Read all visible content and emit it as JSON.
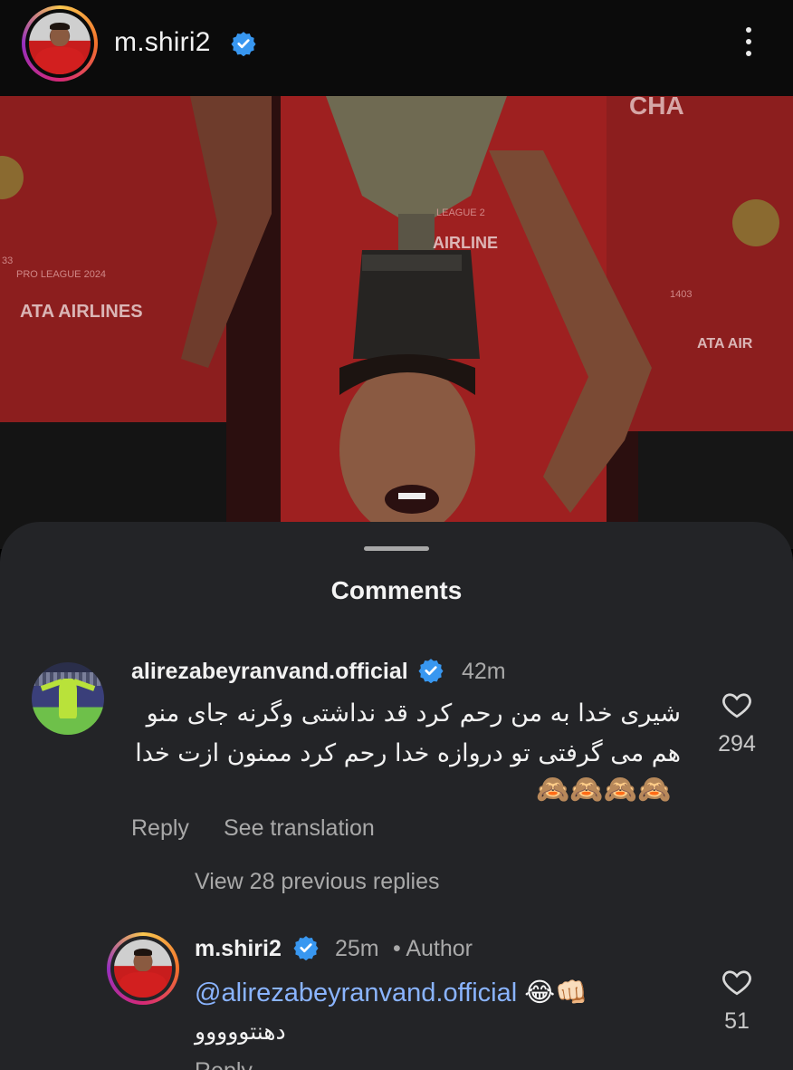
{
  "header": {
    "username": "m.shiri2",
    "verified_icon": "verified-badge-icon",
    "more_icon": "more-vertical-icon"
  },
  "colors": {
    "verified_blue": "#3897f0",
    "sheet_bg": "#232427",
    "mention_blue": "#8ab4ff"
  },
  "photo": {
    "texts": [
      "CHA",
      "LEAGUE 2",
      "AIRLINE",
      "PRO LEAGUE 2024",
      "ATA AIRLINES",
      "ATA AIR",
      "1403",
      "33"
    ]
  },
  "comments_sheet": {
    "title": "Comments",
    "comments": [
      {
        "username": "alirezabeyranvand.official",
        "time": "42m",
        "text_line1": "شیری خدا به من رحم کرد قد نداشتی وگرنه  جای منو",
        "text_line2": "هم می گرفتی تو دروازه خدا رحم کرد ممنون ازت خدا",
        "emojis": "🙈🙈🙈🙈",
        "likes": "294",
        "reply_label": "Reply",
        "translate_label": "See translation",
        "view_replies_label": "View 28 previous replies"
      }
    ],
    "reply": {
      "username": "m.shiri2",
      "time": "25m",
      "author_label": "• Author",
      "mention": "@alirezabeyranvand.official",
      "emojis": "😂👊🏻",
      "text": "دهنتووووو",
      "likes": "51",
      "reply_label": "Reply"
    }
  }
}
